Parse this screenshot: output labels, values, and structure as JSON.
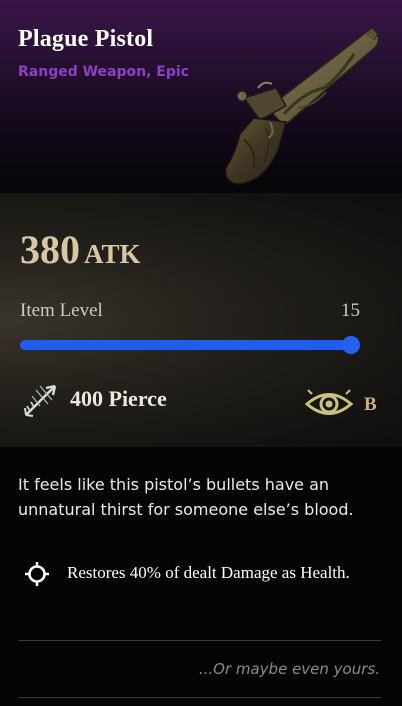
{
  "item": {
    "name": "Plague Pistol",
    "type": "Ranged Weapon, Epic",
    "weapon_icon": "flintlock-pistol-image"
  },
  "stats": {
    "attack_value": "380",
    "attack_unit": "ATK",
    "item_level_label": "Item Level",
    "item_level_value": "15",
    "item_level_fill_fraction": 1.0,
    "pierce_label": "400 Pierce",
    "pierce_icon": "arrow-pierce-icon",
    "perception_icon": "eye-icon",
    "perception_grade": "B"
  },
  "description": "It feels like this pistol’s bullets have an unnatural thirst for someone else’s blood.",
  "effect": {
    "icon": "crosshair-icon",
    "text": "Restores 40% of dealt Damage as Health."
  },
  "flavor_text": "...Or maybe even yours.",
  "colors": {
    "rarity_epic": "#8e3fc4",
    "atk_gold": "#d7c7a4",
    "slider_blue": "#1f5cf0",
    "grade_gold": "#c9b37a"
  }
}
